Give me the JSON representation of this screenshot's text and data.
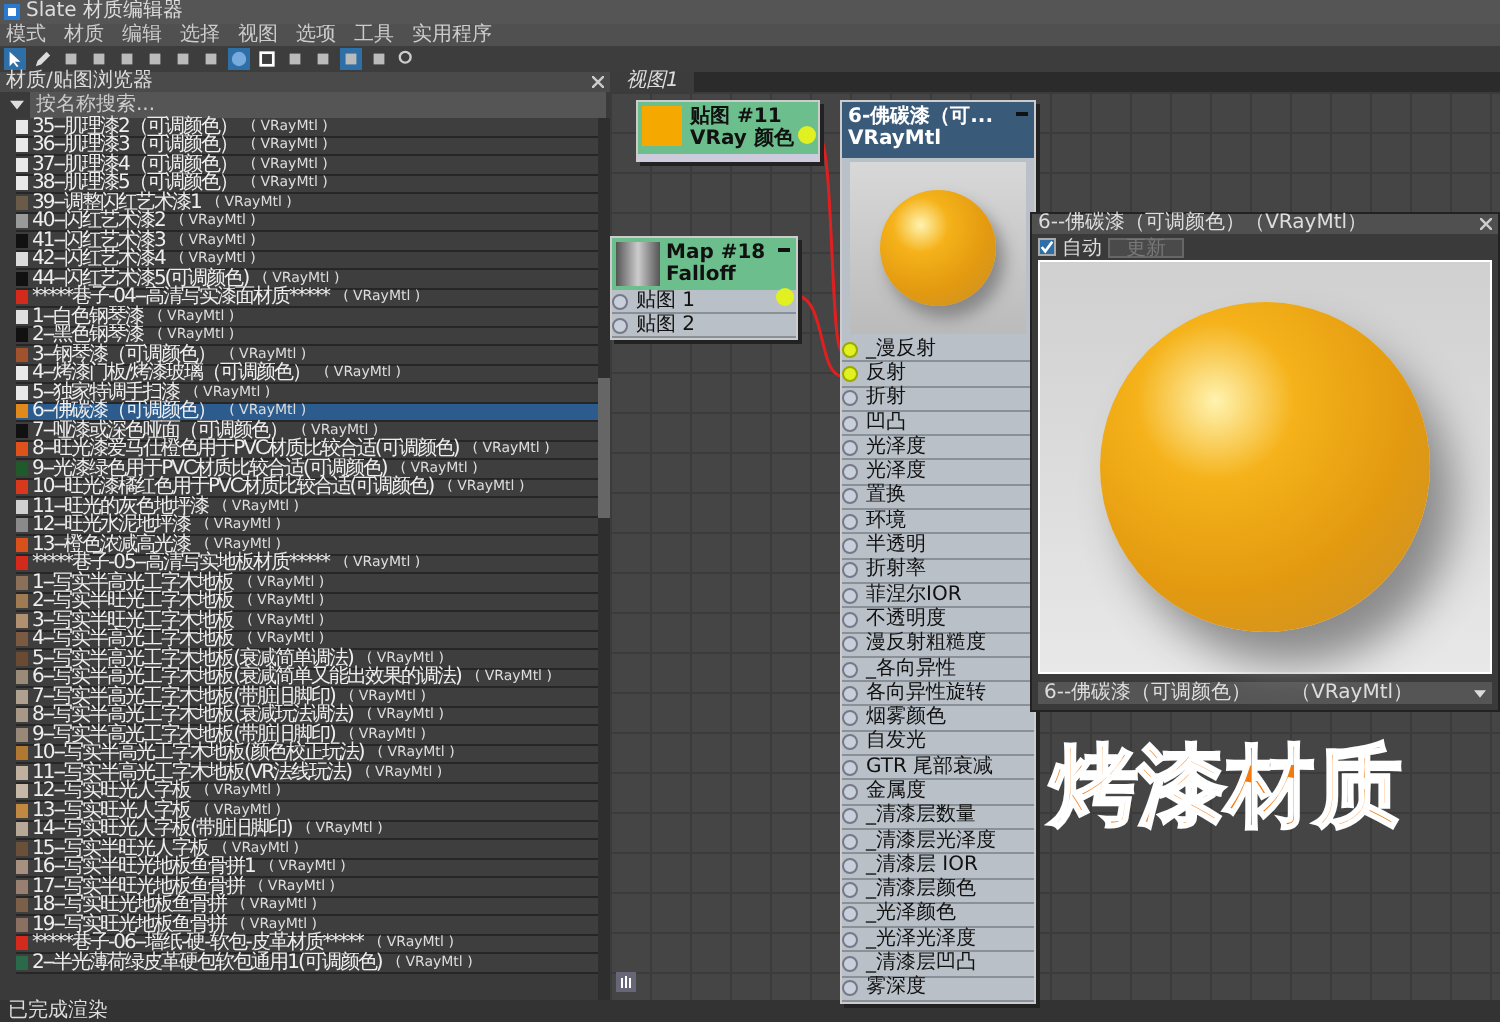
{
  "window": {
    "title": "Slate 材质编辑器"
  },
  "menu": [
    "模式",
    "材质",
    "编辑",
    "选择",
    "视图",
    "选项",
    "工具",
    "实用程序"
  ],
  "browser": {
    "title": "材质/贴图浏览器",
    "search_placeholder": "按名称搜索...",
    "items": [
      {
        "name": "35--肌理漆2（可调颜色）",
        "type": "( VRayMtl )",
        "color": "#e8e8e8",
        "selected": false
      },
      {
        "name": "36--肌理漆3（可调颜色）",
        "type": "( VRayMtl )",
        "color": "#e8e8e8",
        "selected": false
      },
      {
        "name": "37--肌理漆4（可调颜色）",
        "type": "( VRayMtl )",
        "color": "#e8e8e8",
        "selected": false
      },
      {
        "name": "38--肌理漆5（可调颜色）",
        "type": "( VRayMtl )",
        "color": "#e8e8e8",
        "selected": false
      },
      {
        "name": "39--调整闪红艺术漆1",
        "type": "( VRayMtl )",
        "color": "#6a5a48",
        "selected": false
      },
      {
        "name": "40--闪红艺术漆2",
        "type": "( VRayMtl )",
        "color": "#9a9a9a",
        "selected": false
      },
      {
        "name": "41--闪红艺术漆3",
        "type": "( VRayMtl )",
        "color": "#111111",
        "selected": false
      },
      {
        "name": "42--闪红艺术漆4",
        "type": "( VRayMtl )",
        "color": "#dcdcdc",
        "selected": false
      },
      {
        "name": "44--闪红艺术漆5(可调颜色)",
        "type": "( VRayMtl )",
        "color": "#111111",
        "selected": false
      },
      {
        "name": "*****巷子-04--高清写实漆面材质*****",
        "type": "( VRayMtl )",
        "color": "#d42a1c",
        "selected": false
      },
      {
        "name": "1--白色钢琴漆",
        "type": "( VRayMtl )",
        "color": "#e0e0e0",
        "selected": false
      },
      {
        "name": "2--黑色钢琴漆",
        "type": "( VRayMtl )",
        "color": "#111111",
        "selected": false
      },
      {
        "name": "3--钢琴漆（可调颜色）",
        "type": "( VRayMtl )",
        "color": "#a0522d",
        "selected": false
      },
      {
        "name": "4--烤漆门板/烤漆玻璃（可调颜色）",
        "type": "( VRayMtl )",
        "color": "#e8e8e8",
        "selected": false
      },
      {
        "name": "5--独家特调手扫漆",
        "type": "( VRayMtl )",
        "color": "#e8e8e8",
        "selected": false
      },
      {
        "name": "6--佛碳漆（可调颜色）",
        "type": "( VRayMtl )",
        "color": "#e08a1e",
        "selected": true
      },
      {
        "name": "7--哑漆或深色哑面（可调颜色）",
        "type": "( VRayMtl )",
        "color": "#111111",
        "selected": false
      },
      {
        "name": "8--旺光漆爱马仕橙色用于PVC材质比较合适(可调颜色)",
        "type": "( VRayMtl )",
        "color": "#e0521c",
        "selected": false
      },
      {
        "name": "9--光漆绿色用于PVC材质比较合适(可调颜色)",
        "type": "( VRayMtl )",
        "color": "#1e5a2a",
        "selected": false
      },
      {
        "name": "10--旺光漆橘红色用于PVC材质比较合适(可调颜色)",
        "type": "( VRayMtl )",
        "color": "#d8381c",
        "selected": false
      },
      {
        "name": "11--旺光的灰色地坪漆",
        "type": "( VRayMtl )",
        "color": "#d0d0d0",
        "selected": false
      },
      {
        "name": "12--旺光水泥地坪漆",
        "type": "( VRayMtl )",
        "color": "#8a8a8a",
        "selected": false
      },
      {
        "name": "13--橙色浓减高光漆",
        "type": "( VRayMtl )",
        "color": "#d8501c",
        "selected": false
      },
      {
        "name": "*****巷子-05--高清写实地板材质*****",
        "type": "( VRayMtl )",
        "color": "#d42a1c",
        "selected": false
      },
      {
        "name": "1--写实半高光工字木地板",
        "type": "( VRayMtl )",
        "color": "#8a7058",
        "selected": false
      },
      {
        "name": "2--写实半旺光工字木地板",
        "type": "( VRayMtl )",
        "color": "#a07a50",
        "selected": false
      },
      {
        "name": "3--写实半旺光工字木地板",
        "type": "( VRayMtl )",
        "color": "#b09070",
        "selected": false
      },
      {
        "name": "4--写实半高光工字木地板",
        "type": "( VRayMtl )",
        "color": "#7a5a40",
        "selected": false
      },
      {
        "name": "5--写实半高光工字木地板(衰减简单调法)",
        "type": "( VRayMtl )",
        "color": "#6a4a30",
        "selected": false
      },
      {
        "name": "6--写实半高光工字木地板(衰减简单又能出效果的调法)",
        "type": "( VRayMtl )",
        "color": "#9a8a78",
        "selected": false
      },
      {
        "name": "7--写实半高光工字木地板(带脏旧脚印)",
        "type": "( VRayMtl )",
        "color": "#b0a090",
        "selected": false
      },
      {
        "name": "8--写实半高光工字木地板(衰减玩法调法)",
        "type": "( VRayMtl )",
        "color": "#a89888",
        "selected": false
      },
      {
        "name": "9--写实半高光工字木地板(带脏旧脚印)",
        "type": "( VRayMtl )",
        "color": "#988878",
        "selected": false
      },
      {
        "name": "10--写实半高光工字木地板(颜色校正玩法)",
        "type": "( VRayMtl )",
        "color": "#b07830",
        "selected": false
      },
      {
        "name": "11--写实半高光工字木地板(VR法线玩法)",
        "type": "( VRayMtl )",
        "color": "#c0b0a0",
        "selected": false
      },
      {
        "name": "12--写实旺光人字板",
        "type": "( VRayMtl )",
        "color": "#c8b8a8",
        "selected": false
      },
      {
        "name": "13--写实旺光人字板",
        "type": "( VRayMtl )",
        "color": "#c08840",
        "selected": false
      },
      {
        "name": "14--写实旺光人字板(带脏旧脚印)",
        "type": "( VRayMtl )",
        "color": "#b8a898",
        "selected": false
      },
      {
        "name": "15--写实半旺光人字板",
        "type": "( VRayMtl )",
        "color": "#6a5038",
        "selected": false
      },
      {
        "name": "16--写实半旺光地板鱼骨拼1",
        "type": "( VRayMtl )",
        "color": "#a89080",
        "selected": false
      },
      {
        "name": "17--写实半旺光地板鱼骨拼",
        "type": "( VRayMtl )",
        "color": "#988070",
        "selected": false
      },
      {
        "name": "18--写实旺光地板鱼骨拼",
        "type": "( VRayMtl )",
        "color": "#7a6048",
        "selected": false
      },
      {
        "name": "19--写实旺光地板鱼骨拼",
        "type": "( VRayMtl )",
        "color": "#8a7060",
        "selected": false
      },
      {
        "name": "*****巷子-06--墙纸-硬-软包-皮革材质*****",
        "type": "( VRayMtl )",
        "color": "#d42a1c",
        "selected": false
      },
      {
        "name": "2--半光薄荷绿皮革硬包软包通用1(可调颜色)",
        "type": "( VRayMtl )",
        "color": "#2a6a4a",
        "selected": false
      }
    ]
  },
  "view_tab": {
    "label": "视图1",
    "selected": true
  },
  "color_node": {
    "title": "贴图 #11",
    "type": "VRay 颜色",
    "color": "#f5a800"
  },
  "falloff_node": {
    "title": "Map #18",
    "type": "Falloff",
    "slots": [
      {
        "label": "贴图 1",
        "connected": false
      },
      {
        "label": "贴图 2",
        "connected": false
      }
    ]
  },
  "material_node": {
    "title": "6-佛碳漆（可...",
    "type": "VRayMtl",
    "slots": [
      {
        "label": "_漫反射",
        "connected": true
      },
      {
        "label": "反射",
        "connected": true
      },
      {
        "label": "折射",
        "connected": false
      },
      {
        "label": "凹凸",
        "connected": false
      },
      {
        "label": "光泽度",
        "connected": false
      },
      {
        "label": "光泽度",
        "connected": false
      },
      {
        "label": "置换",
        "connected": false
      },
      {
        "label": "环境",
        "connected": false
      },
      {
        "label": "半透明",
        "connected": false
      },
      {
        "label": "折射率",
        "connected": false
      },
      {
        "label": "菲涅尔IOR",
        "connected": false
      },
      {
        "label": "不透明度",
        "connected": false
      },
      {
        "label": "漫反射粗糙度",
        "connected": false
      },
      {
        "label": "_各向异性",
        "connected": false
      },
      {
        "label": "各向异性旋转",
        "connected": false
      },
      {
        "label": "烟雾颜色",
        "connected": false
      },
      {
        "label": "自发光",
        "connected": false
      },
      {
        "label": "GTR 尾部衰减",
        "connected": false
      },
      {
        "label": "金属度",
        "connected": false
      },
      {
        "label": "_清漆层数量",
        "connected": false
      },
      {
        "label": "_清漆层光泽度",
        "connected": false
      },
      {
        "label": "_清漆层 IOR",
        "connected": false
      },
      {
        "label": "_清漆层颜色",
        "connected": false
      },
      {
        "label": "_光泽颜色",
        "connected": false
      },
      {
        "label": "_光泽光泽度",
        "connected": false
      },
      {
        "label": "_清漆层凹凸",
        "connected": false
      },
      {
        "label": "雾深度",
        "connected": false
      }
    ]
  },
  "preview_window": {
    "title": "6--佛碳漆（可调颜色）（VRayMtl）",
    "auto": {
      "label": "自动",
      "checked": true
    },
    "update_button": {
      "label": "更新",
      "disabled": true
    },
    "dropdown": "6--佛碳漆（可调颜色）　　（VRayMtl）"
  },
  "caption": "烤漆材质",
  "status_bar": "已完成渲染"
}
